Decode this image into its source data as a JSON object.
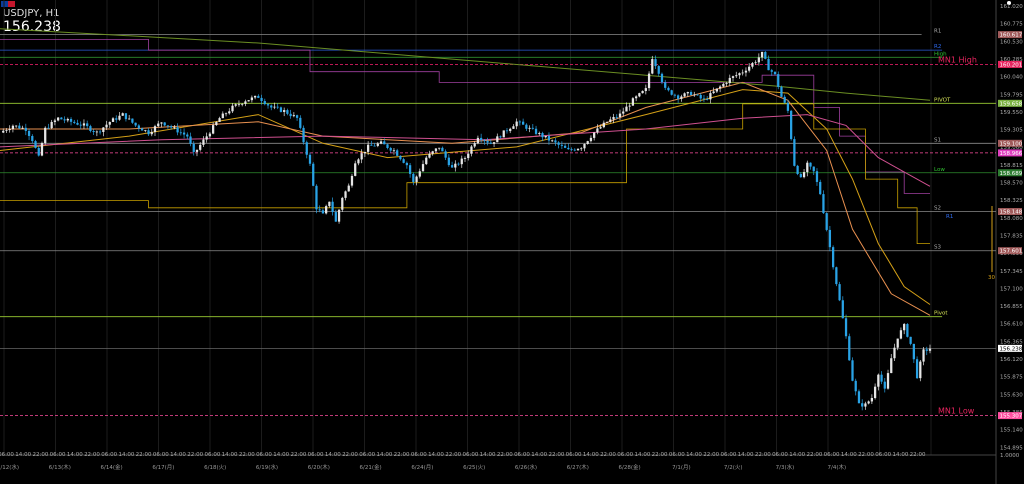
{
  "header": {
    "symbol": "USDJPY, H1",
    "last_price": "156.238"
  },
  "price_axis": {
    "ticks": [
      "161.020",
      "160.775",
      "160.530",
      "160.285",
      "160.040",
      "159.795",
      "159.550",
      "159.305",
      "159.060",
      "158.815",
      "158.570",
      "158.325",
      "158.080",
      "157.835",
      "157.590",
      "157.345",
      "157.100",
      "156.855",
      "156.610",
      "156.365",
      "156.120",
      "155.875",
      "155.630",
      "155.385",
      "155.140",
      "154.895"
    ],
    "bottom_label": "1.0000"
  },
  "time_axis": {
    "hours": [
      "06:00",
      "14:00",
      "22:00"
    ],
    "dates": [
      "6/12(水)",
      "6/13(木)",
      "6/14(金)",
      "6/17(月)",
      "6/18(火)",
      "6/19(水)",
      "6/20(木)",
      "6/21(金)",
      "6/24(月)",
      "6/25(火)",
      "6/26(水)",
      "6/27(木)",
      "6/28(金)",
      "7/1(月)",
      "7/2(火)",
      "7/3(水)",
      "7/4(木)"
    ]
  },
  "levels": [
    {
      "name": "R1",
      "price": 160.617,
      "color": "#8a8a8a",
      "side_label": "R1",
      "side_color": "#aaaaaa",
      "badge": "160.617",
      "badge_color": "#a05a5a",
      "right_end": 0.9
    },
    {
      "name": "R2",
      "price": 160.4,
      "color": "#2a5bd7",
      "side_label": "R2",
      "side_color": "#2f6df5",
      "badge": "",
      "right_end": 0.92
    },
    {
      "name": "High",
      "price": 160.3,
      "color": "#2e8b2e",
      "side_label": "High",
      "side_color": "#31c331",
      "badge": "",
      "right_end": 0.92
    },
    {
      "name": "MN1 High",
      "price": 160.201,
      "color": "#d81b60",
      "side_label": "MN1 High",
      "side_color": "#e8245f",
      "badge": "160.201",
      "badge_color": "#e8245f",
      "dashed": true
    },
    {
      "name": "PIVOT",
      "price": 159.658,
      "color": "#9acd32",
      "side_label": "PIVOT",
      "side_color": "#d4e157",
      "badge": "159.658",
      "badge_color": "#7cb342"
    },
    {
      "name": "S1",
      "price": 159.1,
      "color": "#8a8a8a",
      "side_label": "S1",
      "side_color": "#aaaaaa",
      "badge": "159.100",
      "badge_color": "#a05a5a"
    },
    {
      "name": "MN1 Mid",
      "price": 158.966,
      "color": "#ff4fa0",
      "side_label": "",
      "badge": "158.966",
      "badge_color": "#e040c0",
      "dashed": true
    },
    {
      "name": "Low",
      "price": 158.689,
      "color": "#2e8b2e",
      "side_label": "Low",
      "side_color": "#31c331",
      "badge": "158.689",
      "badge_color": "#2e7d32"
    },
    {
      "name": "S2",
      "price": 158.148,
      "color": "#8a8a8a",
      "side_label": "S2",
      "side_color": "#aaaaaa",
      "badge": "158.148",
      "badge_color": "#a05a5a"
    },
    {
      "name": "S3",
      "price": 157.601,
      "color": "#8a8a8a",
      "side_label": "S3",
      "side_color": "#aaaaaa",
      "badge": "157.601",
      "badge_color": "#a05a5a"
    },
    {
      "name": "Pivot",
      "price": 156.68,
      "color": "#9acd32",
      "side_label": "Pivot",
      "side_color": "#d4e157",
      "badge": "",
      "right_end": 0.92
    },
    {
      "name": "Last",
      "price": 156.238,
      "color": "#666666",
      "side_label": "",
      "badge": "156.238",
      "badge_color": "#ffffff",
      "badge_text": "#000000"
    },
    {
      "name": "MN1 Low",
      "price": 155.3,
      "color": "#ff4fa0",
      "side_label": "MN1 Low",
      "side_color": "#e8245f",
      "badge": "155.307",
      "badge_color": "#ff4fa0",
      "dashed": true
    }
  ],
  "r1_lower": {
    "label": "R1",
    "price": 158.1,
    "color": "#2f6df5"
  },
  "bracket_label": "30",
  "chart_data": {
    "type": "candlestick",
    "title": "USDJPY, H1",
    "ylim": [
      154.75,
      161.1
    ],
    "close_path": [
      [
        0,
        159.25
      ],
      [
        4,
        159.35
      ],
      [
        8,
        159.3
      ],
      [
        10,
        159.15
      ],
      [
        12,
        158.9
      ],
      [
        14,
        159.3
      ],
      [
        18,
        159.45
      ],
      [
        22,
        159.4
      ],
      [
        26,
        159.35
      ],
      [
        30,
        159.25
      ],
      [
        34,
        159.4
      ],
      [
        38,
        159.5
      ],
      [
        42,
        159.35
      ],
      [
        46,
        159.25
      ],
      [
        50,
        159.4
      ],
      [
        54,
        159.3
      ],
      [
        58,
        159.2
      ],
      [
        60,
        158.95
      ],
      [
        64,
        159.2
      ],
      [
        68,
        159.45
      ],
      [
        72,
        159.6
      ],
      [
        76,
        159.7
      ],
      [
        80,
        159.75
      ],
      [
        84,
        159.6
      ],
      [
        88,
        159.55
      ],
      [
        92,
        159.45
      ],
      [
        96,
        158.8
      ],
      [
        98,
        158.2
      ],
      [
        100,
        158.1
      ],
      [
        102,
        158.3
      ],
      [
        104,
        158.0
      ],
      [
        106,
        158.35
      ],
      [
        108,
        158.5
      ],
      [
        110,
        158.85
      ],
      [
        114,
        159.05
      ],
      [
        118,
        159.1
      ],
      [
        122,
        159.0
      ],
      [
        126,
        158.8
      ],
      [
        128,
        158.55
      ],
      [
        132,
        158.9
      ],
      [
        136,
        159.05
      ],
      [
        140,
        158.75
      ],
      [
        144,
        158.9
      ],
      [
        148,
        159.2
      ],
      [
        152,
        159.1
      ],
      [
        156,
        159.25
      ],
      [
        160,
        159.4
      ],
      [
        164,
        159.3
      ],
      [
        168,
        159.2
      ],
      [
        172,
        159.1
      ],
      [
        176,
        159.0
      ],
      [
        180,
        159.05
      ],
      [
        184,
        159.25
      ],
      [
        188,
        159.4
      ],
      [
        192,
        159.5
      ],
      [
        196,
        159.7
      ],
      [
        200,
        159.85
      ],
      [
        202,
        160.3
      ],
      [
        204,
        160.1
      ],
      [
        206,
        159.85
      ],
      [
        210,
        159.75
      ],
      [
        214,
        159.8
      ],
      [
        218,
        159.7
      ],
      [
        222,
        159.85
      ],
      [
        226,
        160.0
      ],
      [
        230,
        160.1
      ],
      [
        234,
        160.25
      ],
      [
        236,
        160.35
      ],
      [
        238,
        160.15
      ],
      [
        240,
        160.05
      ],
      [
        242,
        159.75
      ],
      [
        244,
        159.55
      ],
      [
        246,
        158.8
      ],
      [
        248,
        158.6
      ],
      [
        250,
        158.8
      ],
      [
        252,
        158.7
      ],
      [
        254,
        158.4
      ],
      [
        256,
        157.9
      ],
      [
        258,
        157.4
      ],
      [
        260,
        156.9
      ],
      [
        262,
        156.4
      ],
      [
        264,
        155.8
      ],
      [
        266,
        155.45
      ],
      [
        268,
        155.45
      ],
      [
        270,
        155.55
      ],
      [
        272,
        155.9
      ],
      [
        274,
        155.65
      ],
      [
        276,
        156.1
      ],
      [
        278,
        156.4
      ],
      [
        280,
        156.55
      ],
      [
        282,
        156.3
      ],
      [
        284,
        155.85
      ],
      [
        286,
        156.2
      ],
      [
        288,
        156.238
      ]
    ],
    "moving_averages": [
      {
        "color": "#d4a017",
        "points": [
          [
            0,
            159.0
          ],
          [
            40,
            159.2
          ],
          [
            80,
            159.5
          ],
          [
            100,
            159.1
          ],
          [
            120,
            158.9
          ],
          [
            160,
            159.05
          ],
          [
            200,
            159.5
          ],
          [
            230,
            159.85
          ],
          [
            244,
            159.8
          ],
          [
            256,
            159.3
          ],
          [
            264,
            158.6
          ],
          [
            272,
            157.7
          ],
          [
            280,
            157.1
          ],
          [
            288,
            156.85
          ]
        ]
      },
      {
        "color": "#e89050",
        "points": [
          [
            0,
            159.3
          ],
          [
            40,
            159.3
          ],
          [
            80,
            159.4
          ],
          [
            100,
            159.2
          ],
          [
            140,
            159.1
          ],
          [
            180,
            159.25
          ],
          [
            200,
            159.6
          ],
          [
            230,
            159.95
          ],
          [
            244,
            159.7
          ],
          [
            256,
            159.0
          ],
          [
            264,
            157.9
          ],
          [
            276,
            157.0
          ],
          [
            288,
            156.7
          ]
        ]
      },
      {
        "color": "#d05090",
        "points": [
          [
            0,
            159.05
          ],
          [
            50,
            159.15
          ],
          [
            100,
            159.2
          ],
          [
            150,
            159.15
          ],
          [
            200,
            159.3
          ],
          [
            230,
            159.45
          ],
          [
            250,
            159.5
          ],
          [
            262,
            159.35
          ],
          [
            272,
            158.9
          ],
          [
            288,
            158.5
          ]
        ]
      },
      {
        "color": "#6b8e23",
        "points": [
          [
            0,
            160.7
          ],
          [
            40,
            160.6
          ],
          [
            80,
            160.5
          ],
          [
            120,
            160.35
          ],
          [
            160,
            160.2
          ],
          [
            200,
            160.05
          ],
          [
            240,
            159.9
          ],
          [
            262,
            159.8
          ],
          [
            288,
            159.7
          ]
        ]
      }
    ],
    "step_lines": [
      {
        "color": "#a040a0",
        "points": [
          [
            0,
            160.55
          ],
          [
            46,
            160.55
          ],
          [
            46,
            160.4
          ],
          [
            96,
            160.4
          ],
          [
            96,
            160.1
          ],
          [
            136,
            160.1
          ],
          [
            136,
            159.95
          ],
          [
            236,
            159.95
          ],
          [
            236,
            160.05
          ],
          [
            252,
            160.05
          ],
          [
            252,
            159.6
          ],
          [
            260,
            159.6
          ],
          [
            260,
            159.2
          ],
          [
            268,
            159.2
          ],
          [
            268,
            158.7
          ],
          [
            280,
            158.7
          ],
          [
            280,
            158.4
          ],
          [
            288,
            158.4
          ]
        ]
      },
      {
        "color": "#c8a000",
        "points": [
          [
            0,
            158.3
          ],
          [
            46,
            158.3
          ],
          [
            46,
            158.2
          ],
          [
            126,
            158.2
          ],
          [
            126,
            158.55
          ],
          [
            194,
            158.55
          ],
          [
            194,
            159.3
          ],
          [
            230,
            159.3
          ],
          [
            230,
            159.65
          ],
          [
            252,
            159.65
          ],
          [
            252,
            159.3
          ],
          [
            268,
            159.3
          ],
          [
            268,
            158.6
          ],
          [
            278,
            158.6
          ],
          [
            278,
            158.2
          ],
          [
            284,
            158.2
          ],
          [
            284,
            157.7
          ],
          [
            288,
            157.7
          ]
        ]
      }
    ]
  }
}
